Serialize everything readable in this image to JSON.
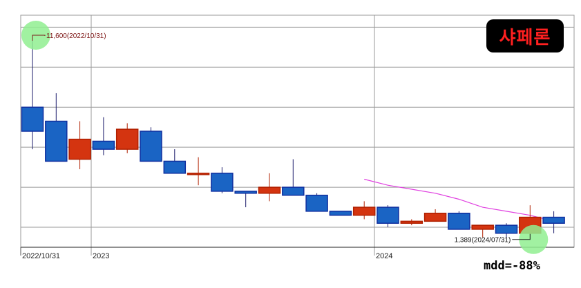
{
  "title": "샤페론",
  "mdd_label": "mdd=-88%",
  "colors": {
    "up": "#d43410",
    "down": "#1a64c4",
    "up_border": "#b02000",
    "down_border": "#1030a0",
    "ma": "#e040e0",
    "highlight": "#90ee90"
  },
  "chart_data": {
    "type": "candlestick",
    "x_labels": [
      "2022/10/31",
      "2023",
      "2024"
    ],
    "annotations": [
      {
        "text": "11,600(2022/10/31)",
        "candle": 0,
        "kind": "high"
      },
      {
        "text": "1,389(2024/07/31)",
        "candle": 21,
        "kind": "low"
      }
    ],
    "ylim": [
      1000,
      12600
    ],
    "y_gridlines": [
      2000,
      4000,
      6000,
      8000,
      10000,
      12000
    ],
    "candles": [
      {
        "open": 8000,
        "high": 11600,
        "low": 5900,
        "close": 6800
      },
      {
        "open": 7300,
        "high": 8700,
        "low": 5300,
        "close": 5300
      },
      {
        "open": 5400,
        "high": 7300,
        "low": 4900,
        "close": 6400
      },
      {
        "open": 6300,
        "high": 7500,
        "low": 5600,
        "close": 5900
      },
      {
        "open": 5900,
        "high": 7200,
        "low": 5700,
        "close": 6900
      },
      {
        "open": 6800,
        "high": 7000,
        "low": 5300,
        "close": 5300
      },
      {
        "open": 5300,
        "high": 5900,
        "low": 4700,
        "close": 4700
      },
      {
        "open": 4700,
        "high": 5500,
        "low": 4100,
        "close": 4700
      },
      {
        "open": 4700,
        "high": 5000,
        "low": 3700,
        "close": 3800
      },
      {
        "open": 3800,
        "high": 3800,
        "low": 3000,
        "close": 3700
      },
      {
        "open": 3700,
        "high": 4700,
        "low": 3300,
        "close": 4000
      },
      {
        "open": 4000,
        "high": 5400,
        "low": 3600,
        "close": 3600
      },
      {
        "open": 3600,
        "high": 3700,
        "low": 2800,
        "close": 2800
      },
      {
        "open": 2800,
        "high": 2800,
        "low": 2600,
        "close": 2600
      },
      {
        "open": 2600,
        "high": 3300,
        "low": 2400,
        "close": 3000
      },
      {
        "open": 3000,
        "high": 3100,
        "low": 2000,
        "close": 2200
      },
      {
        "open": 2200,
        "high": 2400,
        "low": 2100,
        "close": 2300
      },
      {
        "open": 2300,
        "high": 2900,
        "low": 2300,
        "close": 2700
      },
      {
        "open": 2700,
        "high": 2800,
        "low": 1900,
        "close": 1900
      },
      {
        "open": 1900,
        "high": 2100,
        "low": 1500,
        "close": 2100
      },
      {
        "open": 2100,
        "high": 2200,
        "low": 1500,
        "close": 1700
      },
      {
        "open": 1700,
        "high": 3100,
        "low": 1389,
        "close": 2500
      },
      {
        "open": 2500,
        "high": 2800,
        "low": 1700,
        "close": 2200
      }
    ],
    "ma_line": {
      "start_candle": 14,
      "values": [
        4400,
        4100,
        3900,
        3700,
        3400,
        3000,
        2800,
        2600,
        2300
      ]
    }
  }
}
